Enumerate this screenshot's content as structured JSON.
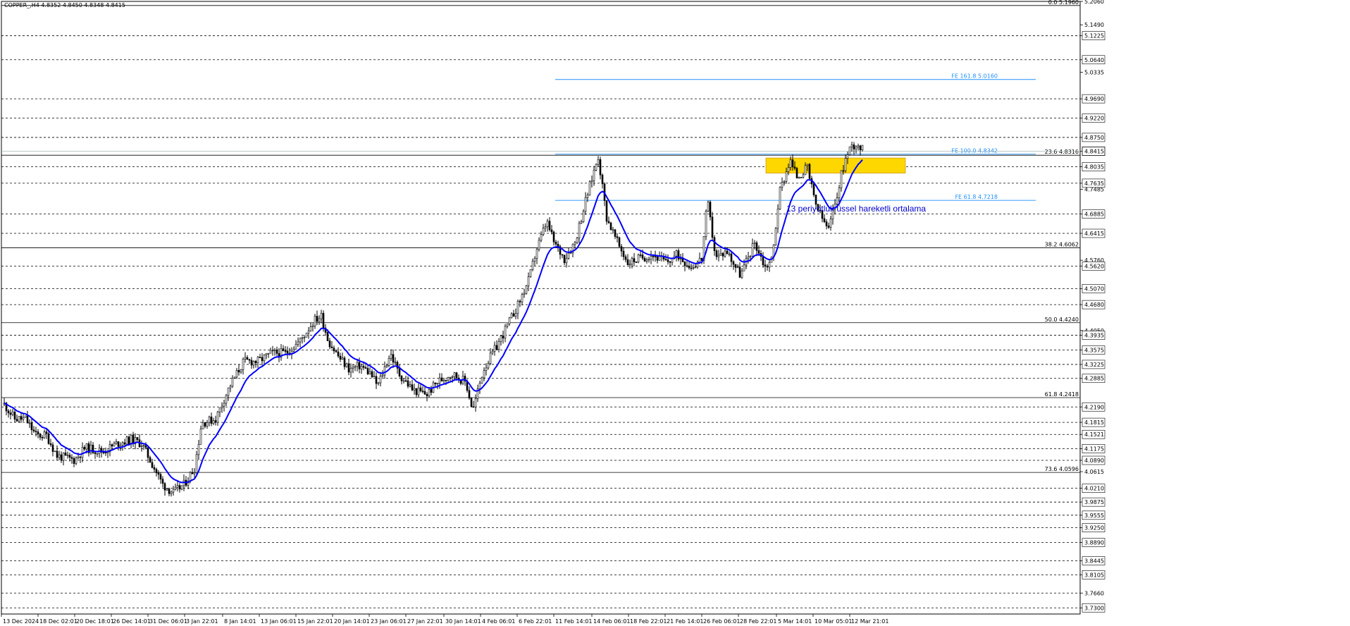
{
  "header": {
    "symbol_line": "COPPER_,H4  4.8352 4.8450 4.8348 4.8415"
  },
  "chart_data": {
    "type": "candlestick",
    "symbol": "COPPER_",
    "timeframe": "H4",
    "ohlc": {
      "open": 4.8352,
      "high": 4.845,
      "low": 4.8348,
      "close": 4.8415
    },
    "ylim": [
      3.715,
      5.206
    ],
    "current_price": 4.8415,
    "x_tick_labels": [
      "13 Dec 2024",
      "18 Dec 02:01",
      "20 Dec 18:01",
      "26 Dec 14:01",
      "31 Dec 06:01",
      "3 Jan 22:01",
      "8 Jan 14:01",
      "13 Jan 06:01",
      "15 Jan 22:01",
      "20 Jan 14:01",
      "23 Jan 06:01",
      "27 Jan 22:01",
      "30 Jan 14:01",
      "4 Feb 06:01",
      "6 Feb 22:01",
      "11 Feb 14:01",
      "14 Feb 06:01",
      "18 Feb 22:01",
      "21 Feb 14:01",
      "26 Feb 06:01",
      "28 Feb 22:01",
      "5 Mar 14:01",
      "10 Mar 05:01",
      "12 Mar 21:01"
    ],
    "y_tick_labels": [
      {
        "v": 5.206,
        "t": "5.2060"
      },
      {
        "v": 5.149,
        "t": "5.1490"
      },
      {
        "v": 5.1225,
        "t": "5.1225",
        "box": true
      },
      {
        "v": 5.064,
        "t": "5.0640",
        "box": true
      },
      {
        "v": 5.0335,
        "t": "5.0335"
      },
      {
        "v": 4.969,
        "t": "4.9690",
        "box": true
      },
      {
        "v": 4.922,
        "t": "4.9220",
        "box": true
      },
      {
        "v": 4.875,
        "t": "4.8750",
        "box": true
      },
      {
        "v": 4.8415,
        "t": "4.8415",
        "current": true
      },
      {
        "v": 4.8035,
        "t": "4.8035",
        "box": true
      },
      {
        "v": 4.7635,
        "t": "4.7635",
        "box": true
      },
      {
        "v": 4.7485,
        "t": "4.7485"
      },
      {
        "v": 4.6885,
        "t": "4.6885",
        "box": true
      },
      {
        "v": 4.6415,
        "t": "4.6415",
        "box": true
      },
      {
        "v": 4.576,
        "t": "4.5760"
      },
      {
        "v": 4.562,
        "t": "4.5620",
        "box": true
      },
      {
        "v": 4.507,
        "t": "4.5070",
        "box": true
      },
      {
        "v": 4.468,
        "t": "4.4680",
        "box": true
      },
      {
        "v": 4.405,
        "t": "4.4050"
      },
      {
        "v": 4.3935,
        "t": "4.3935",
        "box": true
      },
      {
        "v": 4.3575,
        "t": "4.3575",
        "box": true
      },
      {
        "v": 4.3225,
        "t": "4.3225",
        "box": true
      },
      {
        "v": 4.2885,
        "t": "4.2885",
        "box": true
      },
      {
        "v": 4.219,
        "t": "4.2190",
        "box": true
      },
      {
        "v": 4.1815,
        "t": "4.1815",
        "box": true
      },
      {
        "v": 4.1521,
        "t": "4.1521",
        "box": true
      },
      {
        "v": 4.1175,
        "t": "4.1175",
        "box": true
      },
      {
        "v": 4.089,
        "t": "4.0890",
        "box": true
      },
      {
        "v": 4.0615,
        "t": "4.0615"
      },
      {
        "v": 4.021,
        "t": "4.0210",
        "box": true
      },
      {
        "v": 3.9875,
        "t": "3.9875",
        "box": true
      },
      {
        "v": 3.9555,
        "t": "3.9555",
        "box": true
      },
      {
        "v": 3.925,
        "t": "3.9250",
        "box": true
      },
      {
        "v": 3.889,
        "t": "3.8890",
        "box": true
      },
      {
        "v": 3.8445,
        "t": "3.8445",
        "box": true
      },
      {
        "v": 3.8105,
        "t": "3.8105",
        "box": true
      },
      {
        "v": 3.766,
        "t": "3.7660"
      },
      {
        "v": 3.73,
        "t": "3.7300",
        "box": true
      }
    ],
    "dashed_levels": [
      5.1225,
      5.064,
      4.969,
      4.922,
      4.875,
      4.8035,
      4.7635,
      4.6885,
      4.6415,
      4.562,
      4.507,
      4.468,
      4.3935,
      4.3575,
      4.3225,
      4.2885,
      4.219,
      4.1815,
      4.1521,
      4.1175,
      4.089,
      4.021,
      3.9875,
      3.9555,
      3.925,
      3.889,
      3.8445,
      3.8105,
      3.766,
      3.73
    ],
    "fib_retracement": [
      {
        "label": "0.0 5.1960",
        "v": 5.196
      },
      {
        "label": "23.6 4.8316",
        "v": 4.8316
      },
      {
        "label": "38.2 4.6062",
        "v": 4.6062
      },
      {
        "label": "50.0 4.4240",
        "v": 4.424
      },
      {
        "label": "61.8 4.2418",
        "v": 4.2418
      },
      {
        "label": "73.6 4.0596",
        "v": 4.0596
      }
    ],
    "fib_expansion": [
      {
        "label": "FE 161.8 5.0160",
        "v": 5.016
      },
      {
        "label": "FE 100.0 4.8342",
        "v": 4.8342
      },
      {
        "label": "FE 61.8 4.7218",
        "v": 4.7218
      }
    ],
    "support_zone": {
      "from": 4.788,
      "to": 4.825,
      "color": "#ffd700"
    },
    "ema_label": "13 periyotluk üssel hareketli ortalama",
    "colors": {
      "candle": "#000000",
      "ema": "#0000ff",
      "fib_expansion": "#1e90ff",
      "fib_retracement": "#000000",
      "zone": "#ffd700",
      "grid": "#000000"
    },
    "price_path": [
      {
        "t": 0,
        "p": 4.225
      },
      {
        "t": 15,
        "p": 4.19
      },
      {
        "t": 30,
        "p": 4.19
      },
      {
        "t": 45,
        "p": 4.15
      },
      {
        "t": 60,
        "p": 4.15
      },
      {
        "t": 75,
        "p": 4.1
      },
      {
        "t": 100,
        "p": 4.09
      },
      {
        "t": 115,
        "p": 4.12
      },
      {
        "t": 140,
        "p": 4.11
      },
      {
        "t": 160,
        "p": 4.13
      },
      {
        "t": 180,
        "p": 4.14
      },
      {
        "t": 195,
        "p": 4.13
      },
      {
        "t": 210,
        "p": 4.08
      },
      {
        "t": 225,
        "p": 4.03
      },
      {
        "t": 240,
        "p": 4.01
      },
      {
        "t": 255,
        "p": 4.03
      },
      {
        "t": 270,
        "p": 4.07
      },
      {
        "t": 280,
        "p": 4.18
      },
      {
        "t": 300,
        "p": 4.19
      },
      {
        "t": 320,
        "p": 4.27
      },
      {
        "t": 340,
        "p": 4.33
      },
      {
        "t": 360,
        "p": 4.33
      },
      {
        "t": 380,
        "p": 4.35
      },
      {
        "t": 400,
        "p": 4.35
      },
      {
        "t": 420,
        "p": 4.38
      },
      {
        "t": 440,
        "p": 4.43
      },
      {
        "t": 450,
        "p": 4.44
      },
      {
        "t": 460,
        "p": 4.38
      },
      {
        "t": 475,
        "p": 4.34
      },
      {
        "t": 490,
        "p": 4.31
      },
      {
        "t": 505,
        "p": 4.32
      },
      {
        "t": 520,
        "p": 4.3
      },
      {
        "t": 530,
        "p": 4.27
      },
      {
        "t": 548,
        "p": 4.35
      },
      {
        "t": 560,
        "p": 4.3
      },
      {
        "t": 580,
        "p": 4.26
      },
      {
        "t": 600,
        "p": 4.25
      },
      {
        "t": 615,
        "p": 4.28
      },
      {
        "t": 635,
        "p": 4.3
      },
      {
        "t": 655,
        "p": 4.28
      },
      {
        "t": 665,
        "p": 4.21
      },
      {
        "t": 680,
        "p": 4.31
      },
      {
        "t": 700,
        "p": 4.37
      },
      {
        "t": 715,
        "p": 4.42
      },
      {
        "t": 730,
        "p": 4.47
      },
      {
        "t": 745,
        "p": 4.53
      },
      {
        "t": 755,
        "p": 4.6
      },
      {
        "t": 770,
        "p": 4.67
      },
      {
        "t": 780,
        "p": 4.62
      },
      {
        "t": 795,
        "p": 4.58
      },
      {
        "t": 810,
        "p": 4.62
      },
      {
        "t": 825,
        "p": 4.72
      },
      {
        "t": 843,
        "p": 4.83
      },
      {
        "t": 855,
        "p": 4.68
      },
      {
        "t": 870,
        "p": 4.62
      },
      {
        "t": 885,
        "p": 4.57
      },
      {
        "t": 900,
        "p": 4.58
      },
      {
        "t": 920,
        "p": 4.59
      },
      {
        "t": 940,
        "p": 4.57
      },
      {
        "t": 955,
        "p": 4.59
      },
      {
        "t": 975,
        "p": 4.56
      },
      {
        "t": 990,
        "p": 4.58
      },
      {
        "t": 998,
        "p": 4.72
      },
      {
        "t": 1010,
        "p": 4.58
      },
      {
        "t": 1025,
        "p": 4.6
      },
      {
        "t": 1045,
        "p": 4.54
      },
      {
        "t": 1065,
        "p": 4.62
      },
      {
        "t": 1080,
        "p": 4.56
      },
      {
        "t": 1090,
        "p": 4.58
      },
      {
        "t": 1100,
        "p": 4.74
      },
      {
        "t": 1115,
        "p": 4.82
      },
      {
        "t": 1125,
        "p": 4.78
      },
      {
        "t": 1140,
        "p": 4.8
      },
      {
        "t": 1150,
        "p": 4.72
      },
      {
        "t": 1160,
        "p": 4.68
      },
      {
        "t": 1170,
        "p": 4.65
      },
      {
        "t": 1180,
        "p": 4.72
      },
      {
        "t": 1190,
        "p": 4.8
      },
      {
        "t": 1200,
        "p": 4.85
      },
      {
        "t": 1210,
        "p": 4.86
      },
      {
        "t": 1220,
        "p": 4.8415
      }
    ]
  }
}
